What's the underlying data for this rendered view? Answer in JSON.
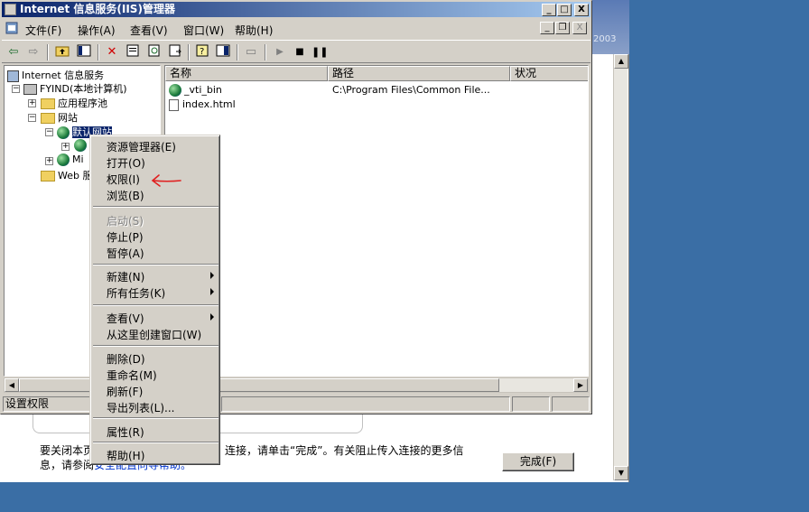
{
  "background_window": {
    "year_label": "2003",
    "body_text_line1_prefix": "要关闭本页",
    "body_text_line1_suffix": "连接，请单击“完成”。有关阻止传入连接的更多信",
    "body_text_line2_prefix": "息，请参阅",
    "body_text_line2_link": "安全配置向导帮助。",
    "finish_button": "完成(F)"
  },
  "window": {
    "title": "Internet 信息服务(IIS)管理器",
    "minimize": "_",
    "maximize": "□",
    "close": "X"
  },
  "menubar": {
    "items": [
      "文件(F)",
      "操作(A)",
      "查看(V)",
      "窗口(W)",
      "帮助(H)"
    ],
    "mdi_minimize": "_",
    "mdi_restore": "❐",
    "mdi_close": "X"
  },
  "tree": {
    "root": "Internet 信息服务",
    "computer": "FYIND(本地计算机)",
    "app_pools": "应用程序池",
    "websites": "网站",
    "default_site": "默认网站",
    "child_site": "",
    "site2": "Mi",
    "web_ext": "Web 服"
  },
  "list": {
    "columns": [
      "名称",
      "路径",
      "状况"
    ],
    "rows": [
      {
        "name": "_vti_bin",
        "path": "C:\\Program Files\\Common File..."
      },
      {
        "name": "index.html",
        "path": ""
      }
    ]
  },
  "status": {
    "text": "设置权限"
  },
  "context_menu": {
    "items": [
      {
        "label": "资源管理器(E)",
        "disabled": false,
        "submenu": false
      },
      {
        "label": "打开(O)",
        "disabled": false,
        "submenu": false
      },
      {
        "label": "权限(I)",
        "disabled": false,
        "submenu": false
      },
      {
        "label": "浏览(B)",
        "disabled": false,
        "submenu": false
      },
      {
        "label": "启动(S)",
        "disabled": true,
        "submenu": false
      },
      {
        "label": "停止(P)",
        "disabled": false,
        "submenu": false
      },
      {
        "label": "暂停(A)",
        "disabled": false,
        "submenu": false
      },
      {
        "label": "新建(N)",
        "disabled": false,
        "submenu": true
      },
      {
        "label": "所有任务(K)",
        "disabled": false,
        "submenu": true
      },
      {
        "label": "查看(V)",
        "disabled": false,
        "submenu": true
      },
      {
        "label": "从这里创建窗口(W)",
        "disabled": false,
        "submenu": false
      },
      {
        "label": "删除(D)",
        "disabled": false,
        "submenu": false
      },
      {
        "label": "重命名(M)",
        "disabled": false,
        "submenu": false
      },
      {
        "label": "刷新(F)",
        "disabled": false,
        "submenu": false
      },
      {
        "label": "导出列表(L)...",
        "disabled": false,
        "submenu": false
      },
      {
        "label": "属性(R)",
        "disabled": false,
        "submenu": false
      },
      {
        "label": "帮助(H)",
        "disabled": false,
        "submenu": false
      }
    ]
  },
  "colors": {
    "title_start": "#0a246a",
    "title_end": "#a6caf0",
    "desktop": "#3a6ea5",
    "annotation": "#e02020"
  }
}
